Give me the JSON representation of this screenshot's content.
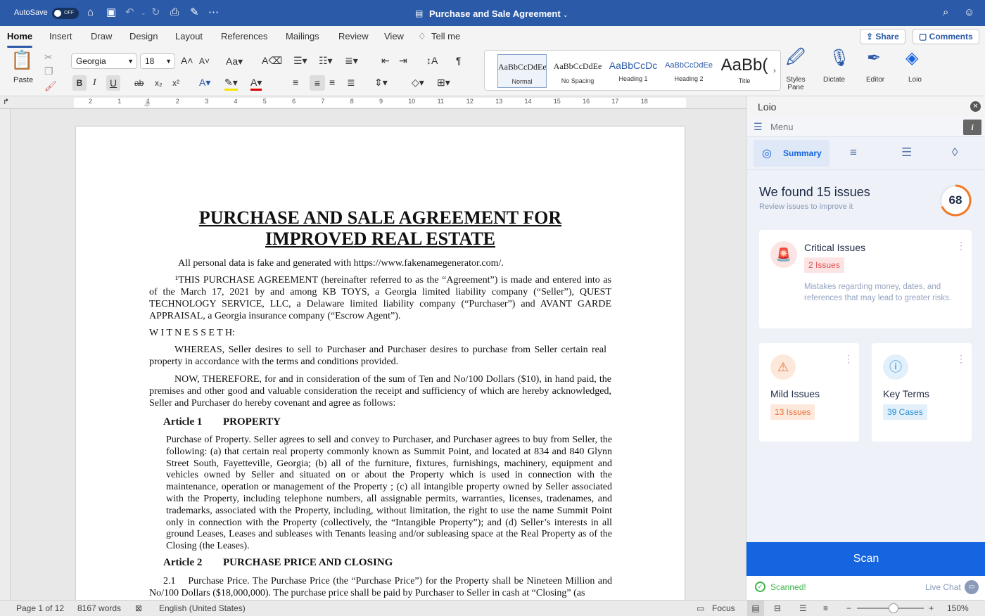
{
  "titlebar": {
    "autosave_label": "AutoSave",
    "autosave_state": "OFF",
    "document_title": "Purchase and Sale Agreement"
  },
  "tabs": [
    "Home",
    "Insert",
    "Draw",
    "Design",
    "Layout",
    "References",
    "Mailings",
    "Review",
    "View",
    "Tell me"
  ],
  "share_label": "Share",
  "comments_label": "Comments",
  "ribbon": {
    "paste_label": "Paste",
    "font_name": "Georgia",
    "font_size": "18",
    "styles": [
      {
        "preview": "AaBbCcDdEe",
        "name": "Normal"
      },
      {
        "preview": "AaBbCcDdEe",
        "name": "No Spacing"
      },
      {
        "preview": "AaBbCcDc",
        "name": "Heading 1"
      },
      {
        "preview": "AaBbCcDdEe",
        "name": "Heading 2"
      },
      {
        "preview": "AaBb(",
        "name": "Title"
      }
    ],
    "styles_pane_label": "Styles Pane",
    "dictate_label": "Dictate",
    "editor_label": "Editor",
    "loio_label": "Loio"
  },
  "ruler_numbers": [
    "2",
    "1",
    "1",
    "2",
    "3",
    "4",
    "5",
    "6",
    "7",
    "8",
    "9",
    "10",
    "11",
    "12",
    "13",
    "14",
    "15",
    "16",
    "17",
    "18"
  ],
  "document": {
    "title_line1": "PURCHASE AND SALE AGREEMENT FOR",
    "title_line2": "IMPROVED REAL ESTATE",
    "disclaimer": "All personal data is fake and generated with https://www.fakenamegenerator.com/.",
    "para1": "¹THIS PURCHASE AGREEMENT (hereinafter referred to as the “Agreement”) is made and entered into as of the March 17, 2021 by and among KB TOYS, a Georgia limited liability company (“Seller”), QUEST TECHNOLOGY SERVICE, LLC, a Delaware limited liability company (“Purchaser”) and AVANT GARDE APPRAISAL, a Georgia insurance company (“Escrow Agent”).",
    "witnesseth": "W I T N E S S E T H:",
    "whereas": "WHEREAS, Seller desires to sell to Purchaser and Purchaser desires to purchase from Seller certain real property in accordance with the terms and conditions provided.",
    "now_therefore": "NOW, THEREFORE, for and in consideration of the sum of Ten and No/100 Dollars ($10), in hand paid, the premises and other good and valuable consideration the receipt and sufficiency of which are hereby acknowledged, Seller and Purchaser do hereby covenant and agree as follows:",
    "article1_num": "Article 1",
    "article1_title": "PROPERTY",
    "article1_body": "Purchase of Property. Seller agrees to sell and convey to Purchaser, and Purchaser agrees to buy from Seller, the following: (a) that certain real property commonly known as Summit Point, and located at 834 and 840 Glynn Street South, Fayetteville, Georgia; (b) all of the furniture, fixtures, furnishings, machinery, equipment and vehicles owned by Seller and situated on or about the Property which is used in connection with the maintenance, operation or management of the Property ; (c) all intangible property owned by Seller associated with the Property, including telephone numbers, all assignable permits, warranties, licenses, tradenames, and trademarks, associated with the Property, including, without limitation, the right to use the name Summit Point only in connection with the Property (collectively, the “Intangible Property”); and (d) Seller’s interests in all ground Leases, Leases and subleases with Tenants leasing and/or subleasing space at the Real Property as of the Closing (the Leases).",
    "article2_num": "Article 2",
    "article2_title": "PURCHASE PRICE AND CLOSING",
    "para21": "2.1    Purchase Price. The Purchase Price (the “Purchase Price”) for the Property shall be Nineteen Million and No/100 Dollars ($18,000,000). The purchase price shall be paid by Purchaser to Seller in cash at “Closing” (as"
  },
  "pane": {
    "title": "Loio",
    "menu_label": "Menu",
    "info_icon": "i",
    "summary_tab": "Summary",
    "found_text": "We found 15 issues",
    "found_sub": "Review issues to improve it",
    "score": "68",
    "score_fraction": 0.68,
    "critical": {
      "title": "Critical Issues",
      "count": "2 Issues",
      "desc": "Mistakes regarding money, dates, and references that may lead to greater risks."
    },
    "mild": {
      "title": "Mild Issues",
      "count": "13 Issues"
    },
    "key": {
      "title": "Key Terms",
      "count": "39 Cases"
    },
    "scan_label": "Scan",
    "scanned_label": "Scanned!",
    "live_chat_label": "Live Chat"
  },
  "status": {
    "page": "Page 1 of 12",
    "words": "8167 words",
    "language": "English (United States)",
    "focus": "Focus",
    "zoom": "150%"
  },
  "colors": {
    "brand": "#2b5aa8",
    "scan": "#1565e0",
    "critical": "#e05252",
    "mild": "#e8743b",
    "key": "#2b8fd6",
    "score_ring": "#f07b2a"
  }
}
